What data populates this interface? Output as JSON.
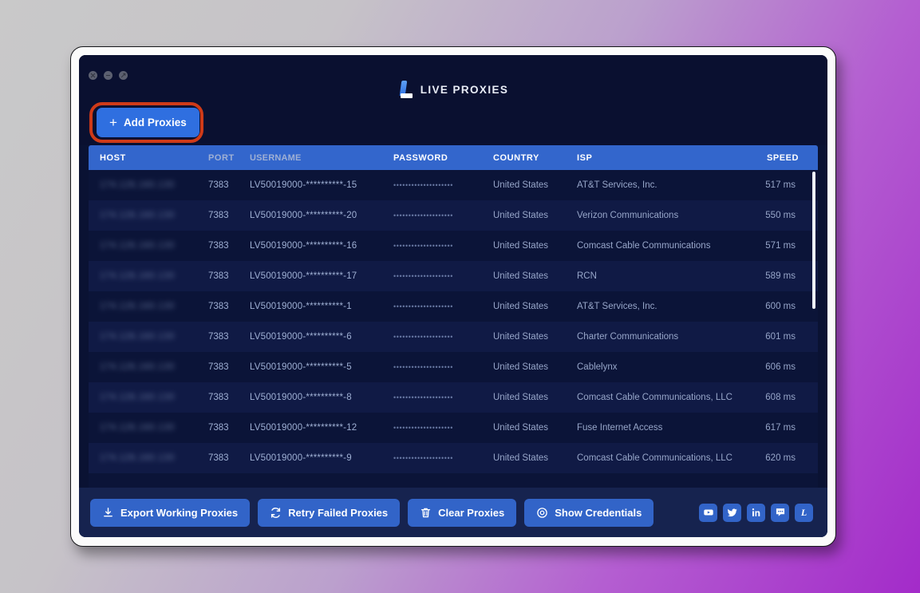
{
  "window": {
    "dots": [
      "close",
      "minimize",
      "maximize"
    ],
    "brand_name": "LIVE PROXIES",
    "brand_icon": "live-proxies-l-logo"
  },
  "actionbar": {
    "add_proxies_label": "Add Proxies",
    "add_proxies_icon": "plus-icon",
    "highlight_color": "#cf3a18"
  },
  "table": {
    "columns": [
      "HOST",
      "PORT",
      "USERNAME",
      "PASSWORD",
      "COUNTRY",
      "ISP",
      "SPEED"
    ],
    "rows": [
      {
        "host": "174.126.160.130",
        "port": "7383",
        "username": "LV50019000-**********-15",
        "password": "••••••••••••••••••••",
        "country": "United States",
        "isp": "AT&T Services, Inc.",
        "speed": "517 ms"
      },
      {
        "host": "174.126.160.130",
        "port": "7383",
        "username": "LV50019000-**********-20",
        "password": "••••••••••••••••••••",
        "country": "United States",
        "isp": "Verizon Communications",
        "speed": "550 ms"
      },
      {
        "host": "174.126.160.130",
        "port": "7383",
        "username": "LV50019000-**********-16",
        "password": "••••••••••••••••••••",
        "country": "United States",
        "isp": "Comcast Cable Communications",
        "speed": "571 ms"
      },
      {
        "host": "174.126.160.130",
        "port": "7383",
        "username": "LV50019000-**********-17",
        "password": "••••••••••••••••••••",
        "country": "United States",
        "isp": "RCN",
        "speed": "589 ms"
      },
      {
        "host": "174.126.160.130",
        "port": "7383",
        "username": "LV50019000-**********-1",
        "password": "••••••••••••••••••••",
        "country": "United States",
        "isp": "AT&T Services, Inc.",
        "speed": "600 ms"
      },
      {
        "host": "174.126.160.130",
        "port": "7383",
        "username": "LV50019000-**********-6",
        "password": "••••••••••••••••••••",
        "country": "United States",
        "isp": "Charter Communications",
        "speed": "601 ms"
      },
      {
        "host": "174.126.160.130",
        "port": "7383",
        "username": "LV50019000-**********-5",
        "password": "••••••••••••••••••••",
        "country": "United States",
        "isp": "Cablelynx",
        "speed": "606 ms"
      },
      {
        "host": "174.126.160.130",
        "port": "7383",
        "username": "LV50019000-**********-8",
        "password": "••••••••••••••••••••",
        "country": "United States",
        "isp": "Comcast Cable Communications, LLC",
        "speed": "608 ms"
      },
      {
        "host": "174.126.160.130",
        "port": "7383",
        "username": "LV50019000-**********-12",
        "password": "••••••••••••••••••••",
        "country": "United States",
        "isp": "Fuse Internet Access",
        "speed": "617 ms"
      },
      {
        "host": "174.126.160.130",
        "port": "7383",
        "username": "LV50019000-**********-9",
        "password": "••••••••••••••••••••",
        "country": "United States",
        "isp": "Comcast Cable Communications, LLC",
        "speed": "620 ms"
      }
    ]
  },
  "footer": {
    "buttons": [
      {
        "label": "Export Working Proxies",
        "icon": "download-icon"
      },
      {
        "label": "Retry Failed Proxies",
        "icon": "refresh-icon"
      },
      {
        "label": "Clear Proxies",
        "icon": "trash-icon"
      },
      {
        "label": "Show Credentials",
        "icon": "eye-target-icon"
      }
    ],
    "social": [
      {
        "name": "youtube-icon",
        "title": "YouTube"
      },
      {
        "name": "twitter-icon",
        "title": "Twitter"
      },
      {
        "name": "linkedin-icon",
        "title": "LinkedIn"
      },
      {
        "name": "discord-icon",
        "title": "Discord"
      },
      {
        "name": "liveproxies-icon",
        "title": "Live Proxies",
        "glyph": "L"
      }
    ]
  },
  "colors": {
    "accent_blue": "#3366cc",
    "button_blue": "#3264c8",
    "window_bg": "#0a1030",
    "table_bg": "#0b1438",
    "footer_bg": "#16234f",
    "highlight_red": "#cf3a18"
  }
}
